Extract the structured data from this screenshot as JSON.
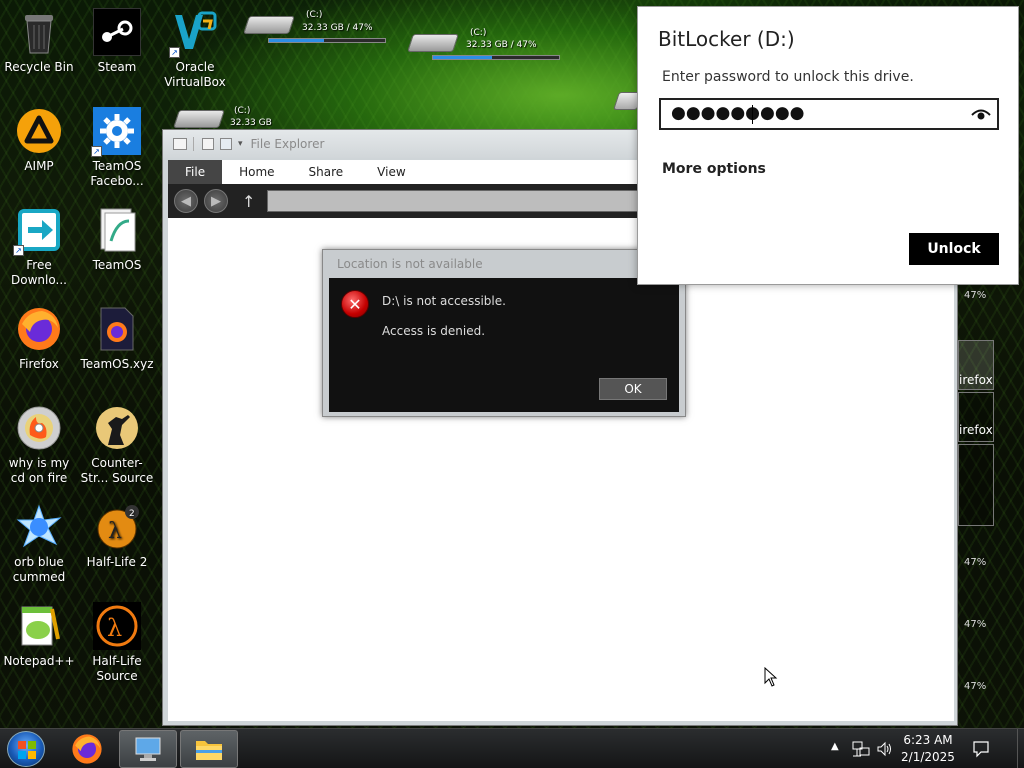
{
  "desktop_icons": [
    {
      "label": "Recycle Bin",
      "icon": "recycle-bin-icon"
    },
    {
      "label": "Steam",
      "icon": "steam-icon"
    },
    {
      "label": "Oracle VirtualBox",
      "icon": "virtualbox-icon"
    },
    {
      "label": "AIMP",
      "icon": "aimp-icon"
    },
    {
      "label": "TeamOS Facebo...",
      "icon": "teamos-facebook-icon"
    },
    {
      "label": "Free Downlo...",
      "icon": "free-download-manager-icon"
    },
    {
      "label": "TeamOS",
      "icon": "teamos-icon"
    },
    {
      "label": "Firefox",
      "icon": "firefox-icon"
    },
    {
      "label": "TeamOS.xyz",
      "icon": "teamos-xyz-icon"
    },
    {
      "label": "why is my cd on fire",
      "icon": "burning-cd-icon"
    },
    {
      "label": "Counter-Str... Source",
      "icon": "counter-strike-icon"
    },
    {
      "label": "orb blue cummed",
      "icon": "blue-orb-icon"
    },
    {
      "label": "Half-Life 2",
      "icon": "half-life-2-icon"
    },
    {
      "label": "Notepad++",
      "icon": "notepad-plus-plus-icon"
    },
    {
      "label": "Half-Life Source",
      "icon": "half-life-source-icon"
    }
  ],
  "drives": [
    {
      "name": "(C:)",
      "info": "32.33 GB / 47%",
      "percent": 47
    },
    {
      "name": "(C:)",
      "info": "32.33 GB / 47%",
      "percent": 47
    },
    {
      "name": "(C:)",
      "info": "32.33 GB",
      "percent": 47
    }
  ],
  "explorer": {
    "title": "File Explorer",
    "tabs": [
      "File",
      "Home",
      "Share",
      "View"
    ]
  },
  "error_dialog": {
    "title": "Location is not available",
    "message1": "D:\\ is not accessible.",
    "message2": "Access is denied.",
    "ok_label": "OK"
  },
  "bitlocker": {
    "title": "BitLocker (D:)",
    "prompt": "Enter password to unlock this drive.",
    "password_mask": "●●●●●●●●●",
    "more_options": "More options",
    "unlock_label": "Unlock"
  },
  "right_edge": {
    "pct": "47%",
    "firefox": "irefox"
  },
  "taskbar": {
    "time": "6:23 AM",
    "date": "2/1/2025"
  },
  "colors": {
    "accent_blue": "#2d8ee6",
    "unlock_bg": "#000000",
    "error_red": "#c40000"
  }
}
